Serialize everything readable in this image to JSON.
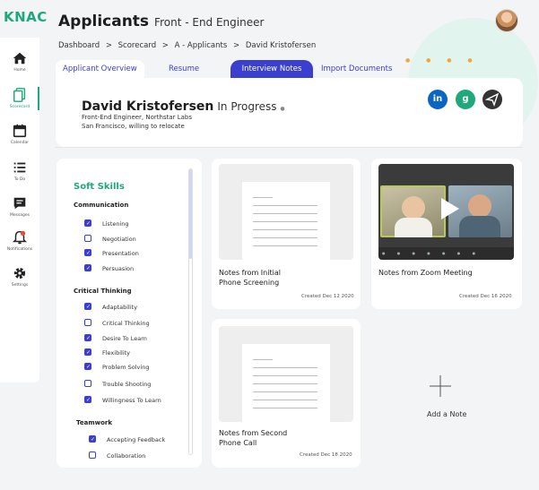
{
  "app": {
    "logo": "KNAC"
  },
  "sidebar": {
    "items": [
      {
        "label": "Home",
        "icon": "home-icon"
      },
      {
        "label": "Scorecard",
        "icon": "scorecard-icon"
      },
      {
        "label": "Calendar",
        "icon": "calendar-icon"
      },
      {
        "label": "To Do",
        "icon": "list-icon"
      },
      {
        "label": "Messages",
        "icon": "message-icon"
      },
      {
        "label": "Notifications",
        "icon": "bell-icon"
      },
      {
        "label": "Settings",
        "icon": "gear-icon"
      }
    ]
  },
  "header": {
    "title": "Applicants",
    "subtitle": "Front - End Engineer"
  },
  "breadcrumb": [
    "Dashboard",
    ">",
    "Scorecard",
    ">",
    "A - Applicants",
    ">",
    "David Kristofersen"
  ],
  "tabs": [
    "Applicant Overview",
    "Resume",
    "Interview Notes",
    "Import Documents"
  ],
  "profile": {
    "name": "David Kristofersen",
    "status": "In Progress",
    "role": "Front-End Engineer, Northstar Labs",
    "location": "San Francisco, willing to relocate"
  },
  "social": [
    "linkedin-icon",
    "glassdoor-icon",
    "send-icon"
  ],
  "skills": {
    "title": "Soft Skills",
    "groups": [
      {
        "name": "Communication",
        "items": [
          {
            "label": "Listening",
            "checked": true
          },
          {
            "label": "Negotiation",
            "checked": false
          },
          {
            "label": "Presentation",
            "checked": true
          },
          {
            "label": "Persuasion",
            "checked": true
          }
        ]
      },
      {
        "name": "Critical Thinking",
        "items": [
          {
            "label": "Adaptability",
            "checked": true
          },
          {
            "label": "Critical Thinking",
            "checked": false
          },
          {
            "label": "Desire To Learn",
            "checked": true
          },
          {
            "label": "Flexibility",
            "checked": true
          },
          {
            "label": "Problem Solving",
            "checked": true
          },
          {
            "label": "Trouble Shooting",
            "checked": false
          },
          {
            "label": "Willingness To Learn",
            "checked": true
          }
        ]
      },
      {
        "name": "Teamwork",
        "items": [
          {
            "label": "Accepting Feedback",
            "checked": true
          },
          {
            "label": "Collaboration",
            "checked": false
          }
        ]
      }
    ]
  },
  "notes": [
    {
      "title_line1": "Notes from Initial",
      "title_line2": "Phone Screening",
      "date": "Created Dec 12 2020"
    },
    {
      "title_line1": "Notes from Zoom Meeting",
      "title_line2": "",
      "date": "Created Dec 16 2020"
    },
    {
      "title_line1": "Notes from Second",
      "title_line2": "Phone Call",
      "date": "Created Dec 18 2020"
    }
  ],
  "add_note": {
    "label": "Add a Note",
    "icon": "plus-icon"
  },
  "colors": {
    "accent_green": "#1fa87a",
    "accent_blue": "#3a3fd0",
    "linkedin": "#0a66c2",
    "glassdoor": "#1fa87a"
  }
}
